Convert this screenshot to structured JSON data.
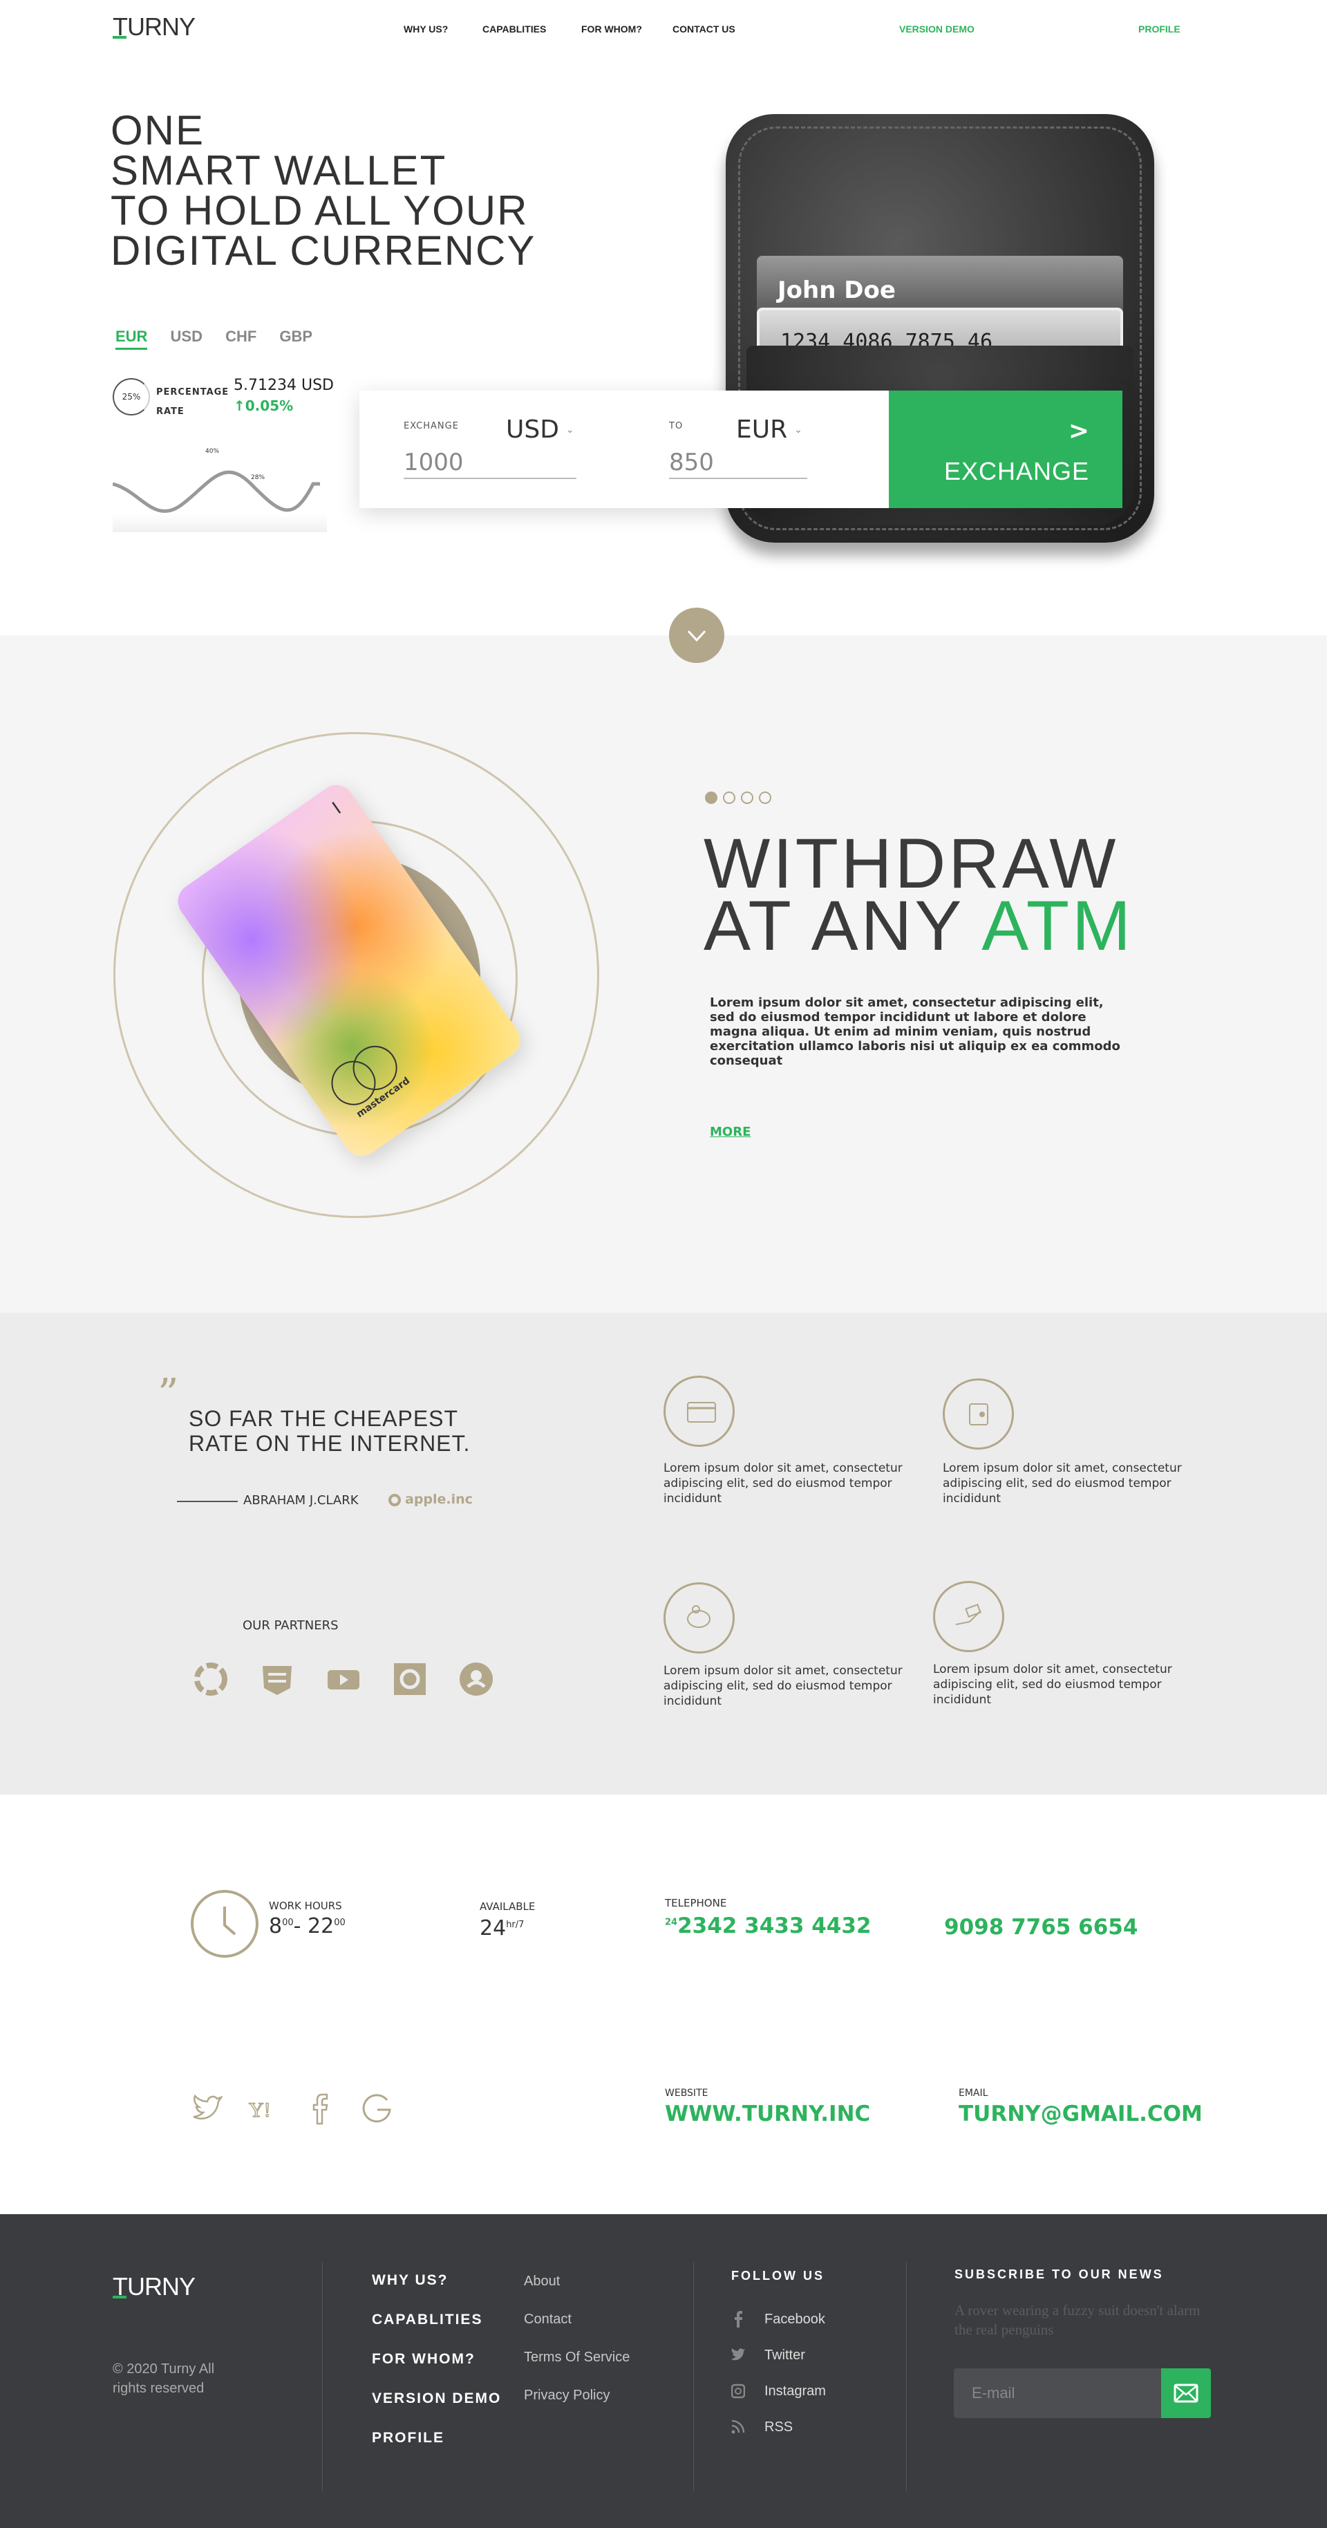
{
  "nav": {
    "logo": "TURNY",
    "items": [
      "WHY US?",
      "CAPABLITIES",
      "FOR WHOM?",
      "CONTACT US"
    ],
    "demo": "VERSION DEMO",
    "profile": "PROFILE"
  },
  "hero": {
    "line1": "ONE",
    "line2": "SMART WALLET",
    "line3": "TO HOLD ALL YOUR",
    "line4": "DIGITAL CURRENCY",
    "tabs": [
      "EUR",
      "USD",
      "CHF",
      "GBP"
    ],
    "rate_badge": "25%",
    "rate_label1": "PERCENTAGE",
    "rate_label2": "RATE",
    "rate_value": "5.71234 USD",
    "rate_change": "↑0.05%",
    "chart_tag1": "40%",
    "chart_tag2": "28%",
    "wallet_name": "John Doe",
    "wallet_number": "1234 4086 7875 46"
  },
  "exchange": {
    "from_label": "EXCHANGE",
    "from_cur": "USD",
    "from_value": "1000",
    "to_label": "TO",
    "to_cur": "EUR",
    "to_value": "850",
    "button": "EXCHANGE",
    "arrow": ">"
  },
  "withdraw": {
    "line1": "WITHDRAW",
    "line2a": "AT ANY ",
    "line2b": "ATM",
    "text": "Lorem ipsum dolor sit amet, consectetur adipiscing elit, sed do eiusmod tempor incididunt ut labore et dolore magna aliqua. Ut enim ad minim veniam, quis nostrud exercitation ullamco laboris nisi ut aliquip ex ea commodo consequat",
    "more": "MORE",
    "card_brand": "mastercard",
    "card_mark": "I"
  },
  "testimonial": {
    "quote_mark": "”",
    "line1": "SO FAR THE CHEAPEST",
    "line2": "RATE ON THE INTERNET.",
    "author": "ABRAHAM J.CLARK",
    "company": "apple.inc",
    "partners_title": "OUR PARTNERS"
  },
  "features": [
    {
      "icon": "credit-card-icon",
      "text": "Lorem ipsum dolor sit amet, consectetur adipiscing elit, sed do eiusmod tempor incididunt"
    },
    {
      "icon": "wallet-icon",
      "text": "Lorem ipsum dolor sit amet, consectetur adipiscing elit, sed do eiusmod tempor incididunt"
    },
    {
      "icon": "piggy-bank-icon",
      "text": "Lorem ipsum dolor sit amet, consectetur adipiscing elit, sed do eiusmod tempor incididunt"
    },
    {
      "icon": "money-hand-icon",
      "text": "Lorem ipsum dolor sit amet, consectetur adipiscing elit, sed do eiusmod tempor incididunt"
    }
  ],
  "contact": {
    "hours_label": "WORK HOURS",
    "hours_from": "8",
    "hours_from_sup": "00",
    "hours_sep": "- ",
    "hours_to": "22",
    "hours_to_sup": "00",
    "available_label": "AVAILABLE",
    "available": "24",
    "available_sup": "hr/7",
    "telephone_label": "TELEPHONE",
    "phone1_prefix": "24",
    "phone1": "2342 3433 4432",
    "phone2": "9098 7765 6654",
    "website_label": "WEBSITE",
    "website": "WWW.TURNY.INC",
    "email_label": "EMAIL",
    "email": "TURNY@GMAIL.COM"
  },
  "footer": {
    "logo": "TURNY",
    "copyright": "© 2020 Turny All rights reserved",
    "menu": [
      "WHY US?",
      "CAPABLITIES",
      "FOR WHOM?",
      "VERSION DEMO",
      "PROFILE"
    ],
    "links": [
      "About",
      "Contact",
      "Terms Of Service",
      "Privacy Policy"
    ],
    "follow_title": "FOLLOW US",
    "follow": [
      "Facebook",
      "Twitter",
      "Instagram",
      "RSS"
    ],
    "subscribe_title": "SUBSCRIBE TO OUR NEWS",
    "subscribe_text": "A rover wearing a fuzzy suit doesn't alarm the real penguins",
    "email_placeholder": "E-mail"
  },
  "colors": {
    "accent": "#2db35d",
    "gold": "#b2a78a",
    "footer": "#3a3c3f"
  }
}
